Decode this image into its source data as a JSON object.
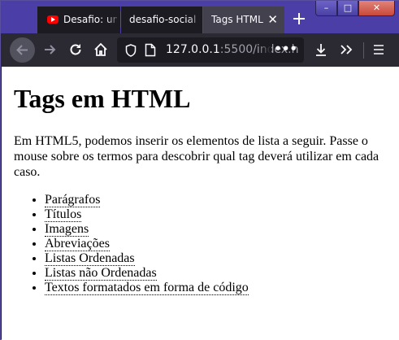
{
  "browser": {
    "tabs": [
      {
        "label": "Desafio: um",
        "icon": "youtube-icon",
        "active": false
      },
      {
        "label": "desafio-social",
        "active": false
      },
      {
        "label": "Tags HTML",
        "active": true
      }
    ],
    "url": {
      "host": "127.0.0.1",
      "rest": ":5500/index.h"
    },
    "window_controls": {
      "minimize": "–",
      "maximize": "□",
      "close": "✕"
    }
  },
  "page": {
    "heading": "Tags em HTML",
    "intro": "Em HTML5, podemos inserir os elementos de lista a seguir. Passe o mouse sobre os termos para descobrir qual tag deverá utilizar em cada caso.",
    "items": [
      "Parágrafos",
      "Títulos",
      "Imagens",
      "Abreviações",
      "Listas Ordenadas",
      "Listas não Ordenadas",
      "Textos formatados em forma de código"
    ]
  }
}
